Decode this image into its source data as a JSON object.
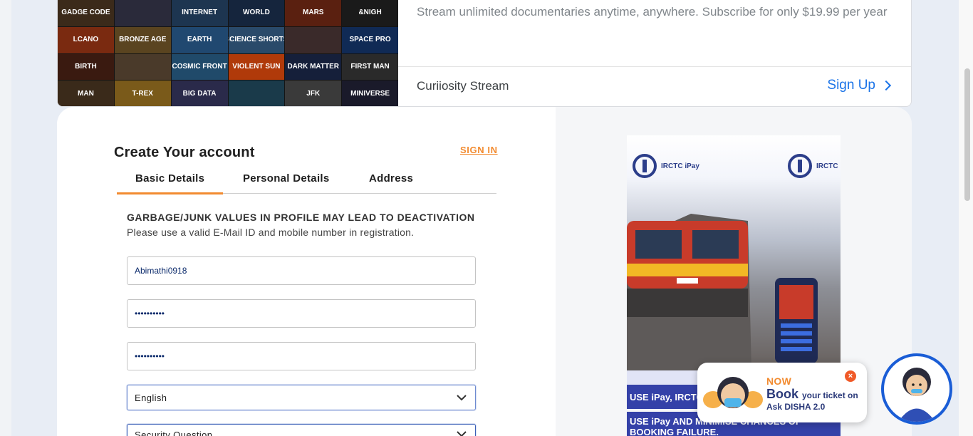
{
  "ad": {
    "description": "Stream unlimited documentaries anytime, anywhere. Subscribe for only $19.99 per year",
    "brand": "Curiiosity Stream",
    "cta": "Sign Up",
    "tiles": [
      "GADGE CODE",
      "",
      "INTERNET",
      "WORLD",
      "MARS",
      "&NIGH",
      "LCANO",
      "BRONZE AGE",
      "EARTH",
      "SCIENCE SHORTS",
      "",
      "SPACE PRO",
      "BIRTH",
      "",
      "COSMIC FRONT",
      "VIOLENT SUN",
      "DARK MATTER",
      "FIRST MAN",
      "MAN",
      "T-REX",
      "BIG DATA",
      "",
      "JFK",
      "MINIVERSE"
    ],
    "tile_colors": [
      "#3b2a1a",
      "#2a2a3a",
      "#1d3550",
      "#15253d",
      "#5a2010",
      "#1a1a1a",
      "#7a2a10",
      "#5a4420",
      "#204870",
      "#2a4a6a",
      "#3a2a2a",
      "#102a55",
      "#3a1a10",
      "#4a3a2a",
      "#204a6a",
      "#b03a0a",
      "#151f3a",
      "#2a2a2a",
      "#3a2a1a",
      "#7a5a1a",
      "#2a2a4a",
      "#1a3a4a",
      "#3a3a3a",
      "#1a1a2a"
    ]
  },
  "form": {
    "title": "Create Your account",
    "sign_in": "SIGN IN",
    "tabs": [
      "Basic Details",
      "Personal Details",
      "Address"
    ],
    "warning_title": "GARBAGE/JUNK VALUES IN PROFILE MAY LEAD TO DEACTIVATION",
    "warning_sub": "Please use a valid E-Mail ID and mobile number in registration.",
    "username": "Abimathi0918",
    "password": "••••••••••",
    "confirm_password": "••••••••••",
    "language": "English",
    "security_question": "Security Question"
  },
  "promo": {
    "brand_left": "IRCTC iPay",
    "brand_right": "IRCTC",
    "bar1": "USE iPay, IRCTC",
    "bar2": "USE iPay AND MINIMISE CHANCES OF BOOKING FAILURE."
  },
  "disha": {
    "now": "NOW",
    "book": "Book",
    "book_rest": "your ticket on",
    "name": "Ask DISHA 2.0",
    "close": "×"
  }
}
